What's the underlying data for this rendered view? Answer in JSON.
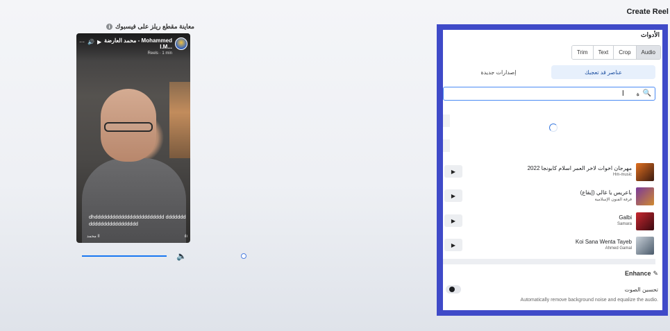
{
  "page": {
    "title": "Create Reel"
  },
  "preview": {
    "label": "معاينة مقطع ريلز على فيسبوك",
    "info_icon": "i",
    "page_name": "محمد العارضة - Mohammed I.M...",
    "reel_meta": "Reels · 1 min",
    "caption": "dhdddddddddddddddddddddddd dddddddddddddddddddddddd",
    "bottom_left": "محمد II",
    "volume_glyph": "🔈"
  },
  "tools": {
    "title": "الأدوات",
    "tabs": [
      {
        "label": "Trim",
        "active": false
      },
      {
        "label": "Text",
        "active": false
      },
      {
        "label": "Crop",
        "active": false
      },
      {
        "label": "Audio",
        "active": true
      }
    ],
    "segments": {
      "active": "عناصر قد تعجبك",
      "other": "إصدارات جديدة"
    },
    "search": {
      "value": "ة",
      "placeholder": ""
    }
  },
  "tracks": [
    {
      "title": "مهرجان اخوات لاخر العمر اسلام كابونجا 2022",
      "artist": "Hm-music",
      "thumb_color": "#c85a18"
    },
    {
      "title": "باعريس يا غالي (إيقاع)",
      "artist": "فرقة الفنون الإسلامية",
      "thumb_color": "#6a2a7a"
    },
    {
      "title": "Galbi",
      "artist": "Samara",
      "thumb_color": "#b8202a"
    },
    {
      "title": "Koi Sana Wenta Tayeb",
      "artist": "Ahmed Gamal",
      "thumb_color": "#8a9aa8"
    }
  ],
  "enhance": {
    "title": "Enhance",
    "label": "تحسين الصوت",
    "description": "Automatically remove background noise and equalize the audio."
  }
}
